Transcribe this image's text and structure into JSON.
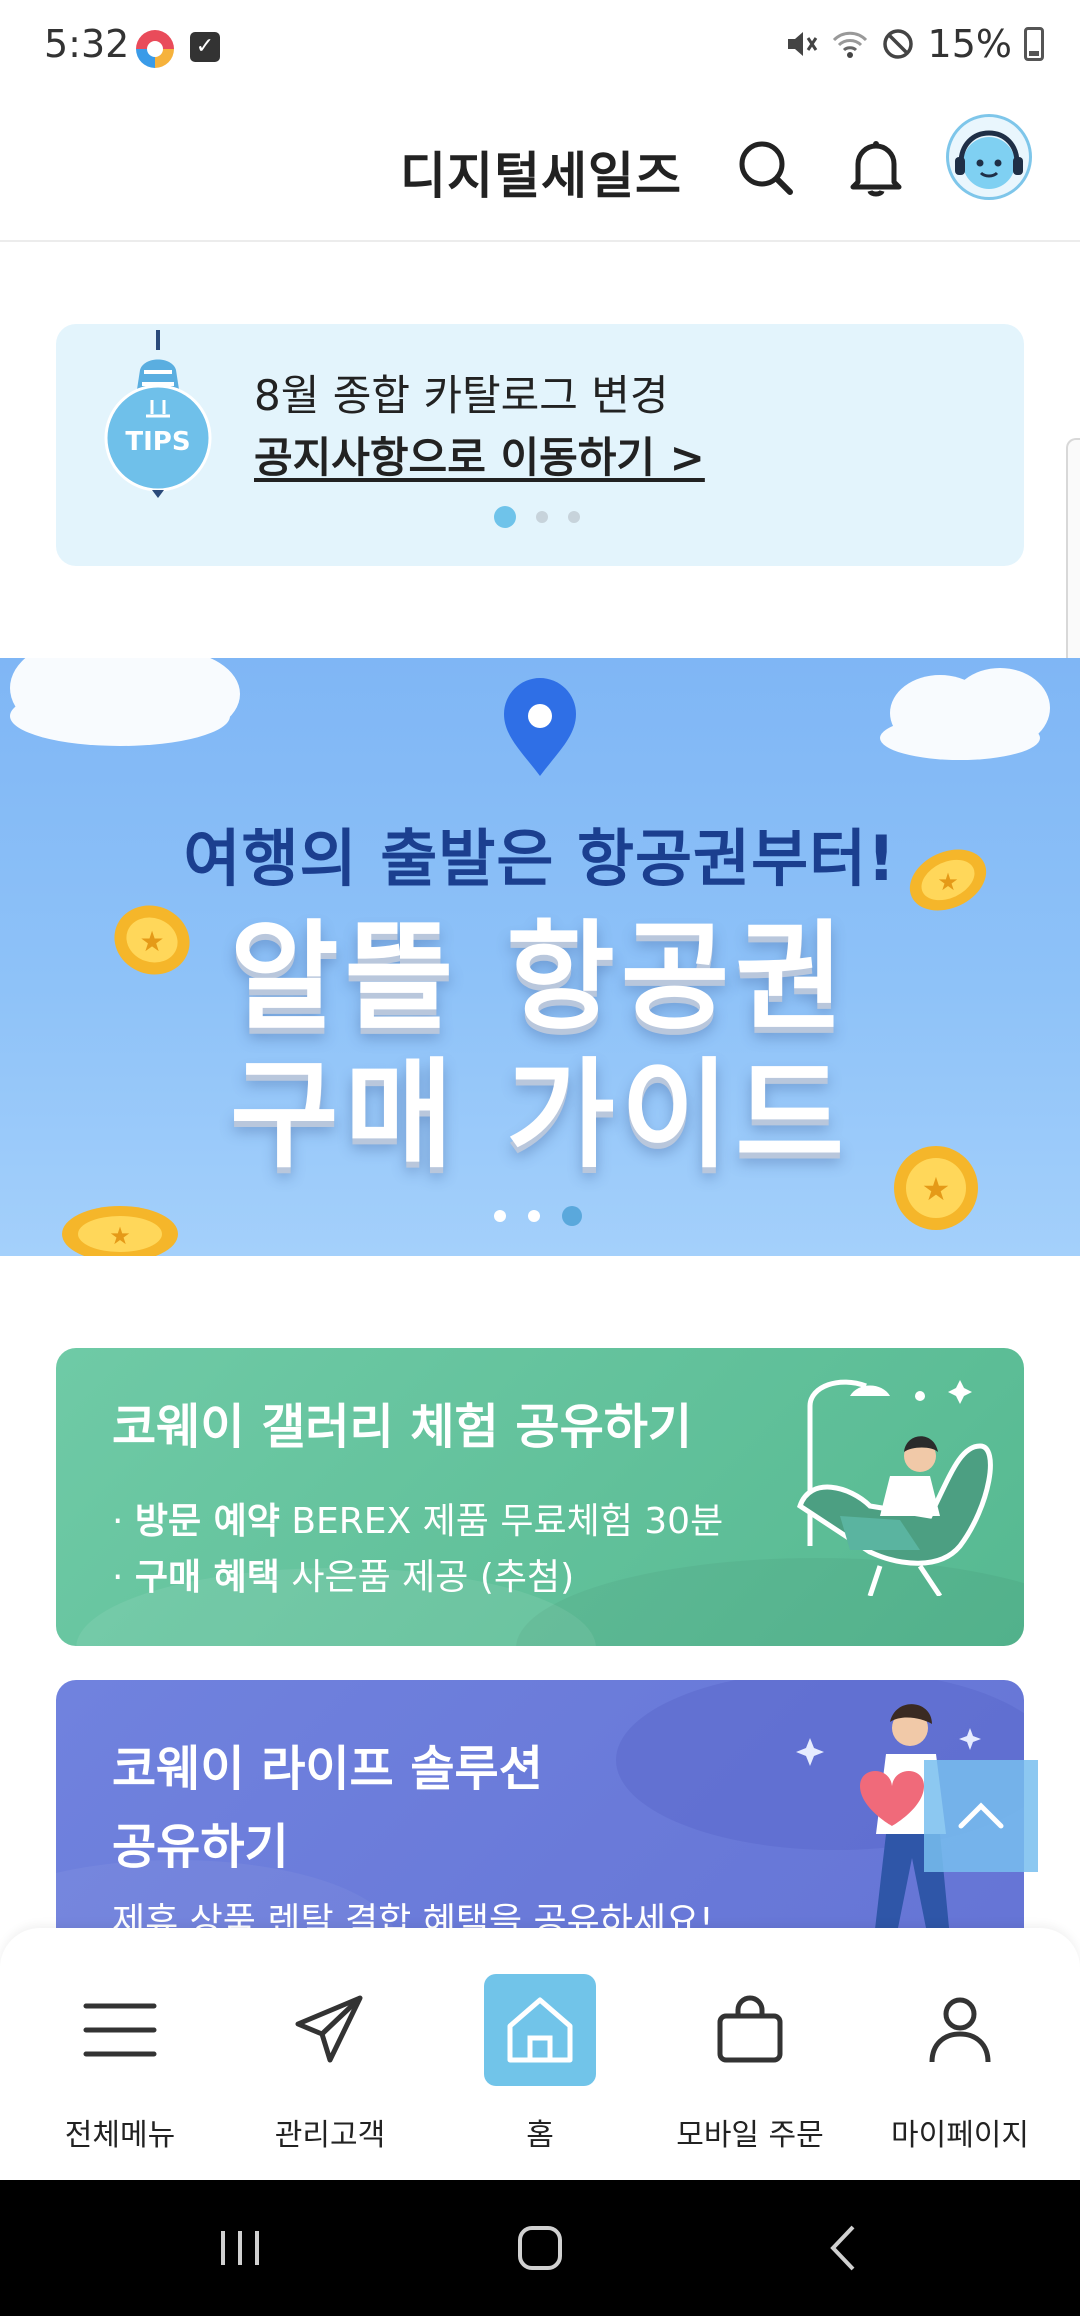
{
  "status_bar": {
    "time": "5:32",
    "battery": "15%"
  },
  "header": {
    "title": "디지털세일즈"
  },
  "tips_banner": {
    "badge": "TIPS",
    "line1": "8월 종합 카탈로그 변경",
    "link": "공지사항으로 이동하기 >",
    "page_count": 3,
    "active_page": 1
  },
  "hero_banner": {
    "subtitle": "여행의 출발은 항공권부터!",
    "title_line1": "알뜰 항공권",
    "title_line2": "구매 가이드",
    "page_count": 3,
    "active_page": 3
  },
  "promo_gallery": {
    "title": "코웨이 갤러리 체험 공유하기",
    "item1_bold": "방문 예약",
    "item1_text": " BEREX 제품 무료체험 30분",
    "item2_bold": "구매 혜택",
    "item2_text": " 사은품 제공 (추첨)",
    "color": "#5fc09b"
  },
  "promo_life": {
    "title_line1": "코웨이 라이프 솔루션",
    "title_line2": "공유하기",
    "subtitle": "제휴 상품 렌탈 결합 혜택을 공유하세요!",
    "color": "#6b7bd9"
  },
  "bottom_nav": {
    "items": [
      {
        "label": "전체메뉴",
        "icon": "menu-icon"
      },
      {
        "label": "관리고객",
        "icon": "paper-plane-icon"
      },
      {
        "label": "홈",
        "icon": "home-icon",
        "active": true
      },
      {
        "label": "모바일 주문",
        "icon": "shopping-bag-icon"
      },
      {
        "label": "마이페이지",
        "icon": "person-icon"
      }
    ]
  },
  "colors": {
    "accent": "#71c4e9",
    "tips_bg": "#e3f4fc",
    "hero_bg": "#8ec2f8"
  }
}
